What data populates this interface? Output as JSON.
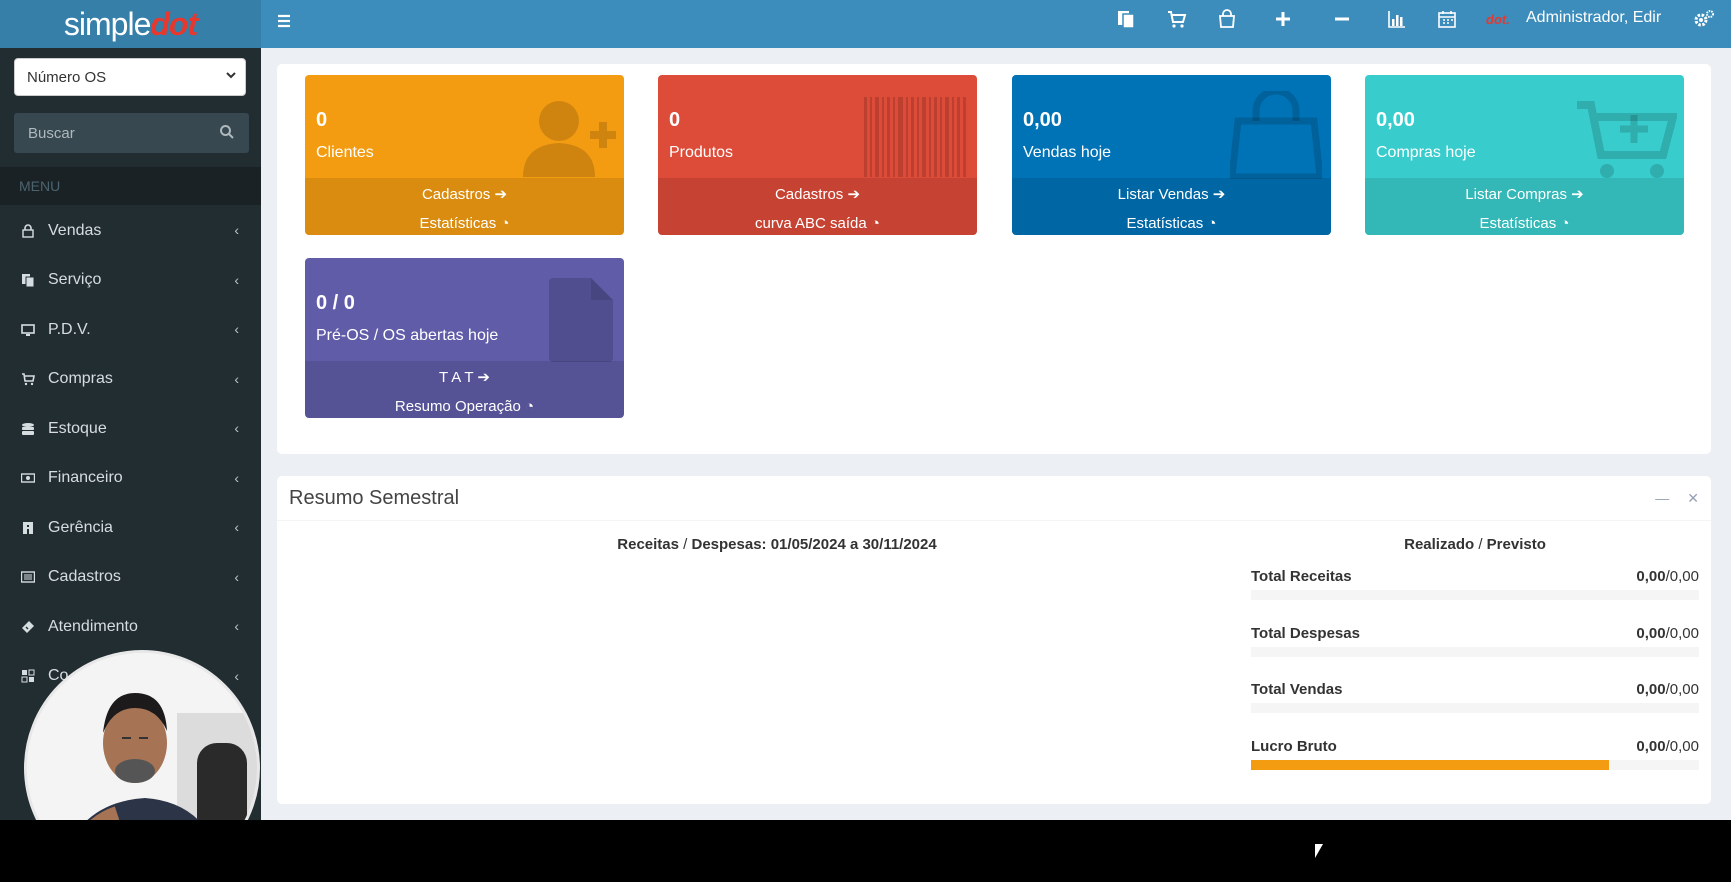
{
  "logo": {
    "simple": "simple",
    "dot": "dot"
  },
  "sidebar": {
    "select_value": "Número OS",
    "search_placeholder": "Buscar",
    "menu_header": "MENU",
    "items": [
      {
        "label": "Vendas",
        "icon": "lock-icon"
      },
      {
        "label": "Serviço",
        "icon": "copy-icon"
      },
      {
        "label": "P.D.V.",
        "icon": "desktop-icon"
      },
      {
        "label": "Compras",
        "icon": "cart-icon"
      },
      {
        "label": "Estoque",
        "icon": "database-icon"
      },
      {
        "label": "Financeiro",
        "icon": "money-icon"
      },
      {
        "label": "Gerência",
        "icon": "building-icon"
      },
      {
        "label": "Cadastros",
        "icon": "list-icon"
      },
      {
        "label": "Atendimento",
        "icon": "ticket-icon"
      },
      {
        "label": "Co",
        "icon": "grid-icon"
      }
    ]
  },
  "topbar": {
    "user": "Administrador, Edir",
    "user_tag": "dot."
  },
  "tiles": [
    {
      "value": "0",
      "label": "Clientes",
      "link1": "Cadastros",
      "link2": "Estatísticas",
      "color": "#f39c12"
    },
    {
      "value": "0",
      "label": "Produtos",
      "link1": "Cadastros",
      "link2": "curva ABC saída",
      "color": "#dd4b39"
    },
    {
      "value": "0,00",
      "label": "Vendas hoje",
      "link1": "Listar Vendas",
      "link2": "Estatísticas",
      "color": "#0073b7"
    },
    {
      "value": "0,00",
      "label": "Compras hoje",
      "link1": "Listar Compras",
      "link2": "Estatísticas",
      "color": "#39cccc"
    },
    {
      "value": "0 / 0",
      "label": "Pré-OS / OS abertas hoje",
      "link1": "T A T",
      "link2": "Resumo Operação",
      "color": "#605ca8"
    }
  ],
  "resumo": {
    "title": "Resumo Semestral",
    "chart_title_a": "Receitas",
    "chart_title_b": " / ",
    "chart_title_c": "Despesas: 01/05/2024 a 30/11/2024",
    "panel_title_a": "Realizado",
    "panel_title_b": " / ",
    "panel_title_c": "Previsto",
    "rows": [
      {
        "name": "Total Receitas",
        "realizado": "0,00",
        "previsto": "/0,00",
        "fill": 0,
        "color": "#3c8dbc"
      },
      {
        "name": "Total Despesas",
        "realizado": "0,00",
        "previsto": "/0,00",
        "fill": 0,
        "color": "#dd4b39"
      },
      {
        "name": "Total Vendas",
        "realizado": "0,00",
        "previsto": "/0,00",
        "fill": 0,
        "color": "#00a65a"
      },
      {
        "name": "Lucro Bruto",
        "realizado": "0,00",
        "previsto": "/0,00",
        "fill": 0.8,
        "color": "#f39c12"
      }
    ]
  }
}
